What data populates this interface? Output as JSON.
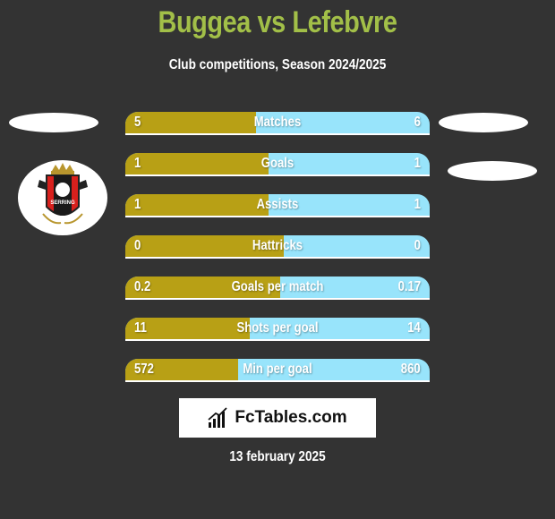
{
  "header": {
    "title": "Buggea vs Lefebvre",
    "subtitle": "Club competitions, Season 2024/2025"
  },
  "colors": {
    "background": "#333333",
    "title": "#a2bf48",
    "left_bar": "#b8a015",
    "right_bar": "#98e4fb"
  },
  "left_team": {
    "logo_icon": "serring-club-crest",
    "logo_text": "SERRING"
  },
  "stats": [
    {
      "label": "Matches",
      "left": "5",
      "right": "6",
      "left_share": 0.43
    },
    {
      "label": "Goals",
      "left": "1",
      "right": "1",
      "left_share": 0.47
    },
    {
      "label": "Assists",
      "left": "1",
      "right": "1",
      "left_share": 0.47
    },
    {
      "label": "Hattricks",
      "left": "0",
      "right": "0",
      "left_share": 0.52
    },
    {
      "label": "Goals per match",
      "left": "0.2",
      "right": "0.17",
      "left_share": 0.51
    },
    {
      "label": "Shots per goal",
      "left": "11",
      "right": "14",
      "left_share": 0.41
    },
    {
      "label": "Min per goal",
      "left": "572",
      "right": "860",
      "left_share": 0.37
    }
  ],
  "footer": {
    "brand": "FcTables.com",
    "brand_icon": "bar-chart-icon",
    "date": "13 february 2025"
  }
}
